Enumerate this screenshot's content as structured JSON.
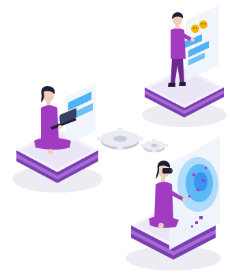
{
  "illustration": {
    "figures": [
      {
        "id": "top-right",
        "pose": "standing",
        "screen": "chat-emoji-panels"
      },
      {
        "id": "left",
        "pose": "sitting",
        "screen": "chat-panels-laptop"
      },
      {
        "id": "bottom-right",
        "pose": "kneeling-vr-headset",
        "screen": "holographic-blue-panel"
      }
    ],
    "center_element": "gears-icon"
  },
  "colors": {
    "background": "#ffffff",
    "platform_top": "#f4f1fb",
    "platform_band": "#7b3fb3",
    "platform_band_light": "#a56bd3",
    "platform_side": "#e7e2f2",
    "shadow": "#e8e8ee",
    "shirt": "#a03bc2",
    "shirt_dark": "#6f2a92",
    "skin": "#f2cdb7",
    "hair": "#1d1f3a",
    "screen_blue": "#4fb3f5",
    "screen_blue_light": "#9fd6fb",
    "emoji": "#f5b400",
    "gear": "#e9ecf2",
    "gear_edge": "#c9ccd8",
    "holo": "#2d8cf0"
  }
}
